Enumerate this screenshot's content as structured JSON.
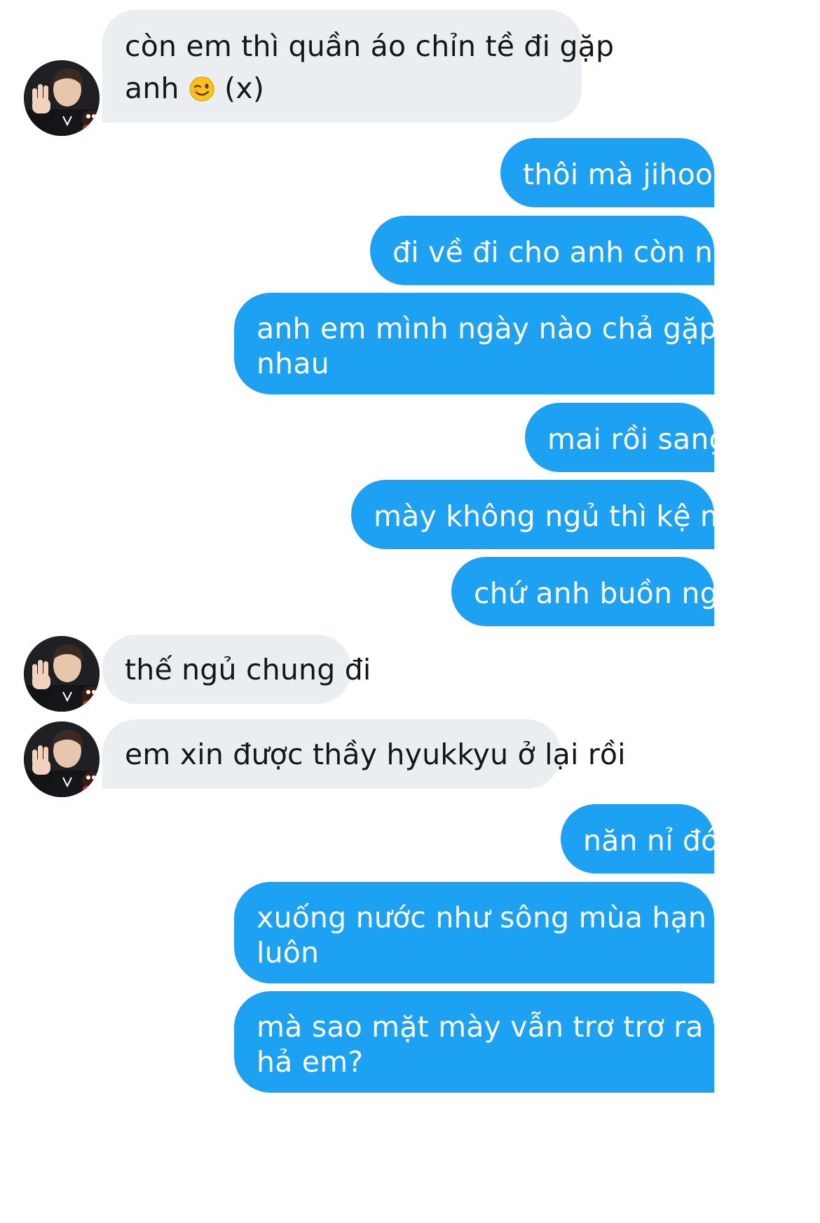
{
  "conversation": {
    "messages": [
      {
        "direction": "incoming",
        "lines": [
          "còn em thì quần áo chỉn tề đi gặp",
          "anh"
        ],
        "emoji": "wink-emoji",
        "suffix": " (x)"
      },
      {
        "direction": "outgoing",
        "text": "thôi mà jihoon"
      },
      {
        "direction": "outgoing",
        "text": "đi về đi cho anh còn ngủ"
      },
      {
        "direction": "outgoing",
        "lines": [
          "anh em mình ngày nào chả gặp",
          "nhau"
        ]
      },
      {
        "direction": "outgoing",
        "text": "mai rồi sang"
      },
      {
        "direction": "outgoing",
        "text": "mày không ngủ thì kệ mày"
      },
      {
        "direction": "outgoing",
        "text": "chứ anh buồn ngủ"
      },
      {
        "direction": "incoming",
        "text": "thế ngủ chung đi"
      },
      {
        "direction": "incoming",
        "text": "em xin được thầy hyukkyu ở lại rồi"
      },
      {
        "direction": "outgoing",
        "text": "năn nỉ đó"
      },
      {
        "direction": "outgoing",
        "lines": [
          "xuống nước như sông mùa hạn hán",
          "luôn"
        ]
      },
      {
        "direction": "outgoing",
        "lines": [
          "mà sao mặt mày vẫn trơ trơ ra thế",
          "hả em?"
        ]
      }
    ]
  },
  "colors": {
    "incoming_bubble": "#ebeef0",
    "incoming_text": "#14171a",
    "outgoing_bubble": "#1da1f2",
    "outgoing_text": "#ffffff"
  },
  "icons": {
    "avatar": "profile-photo",
    "emoji": "winking-face-emoji"
  }
}
